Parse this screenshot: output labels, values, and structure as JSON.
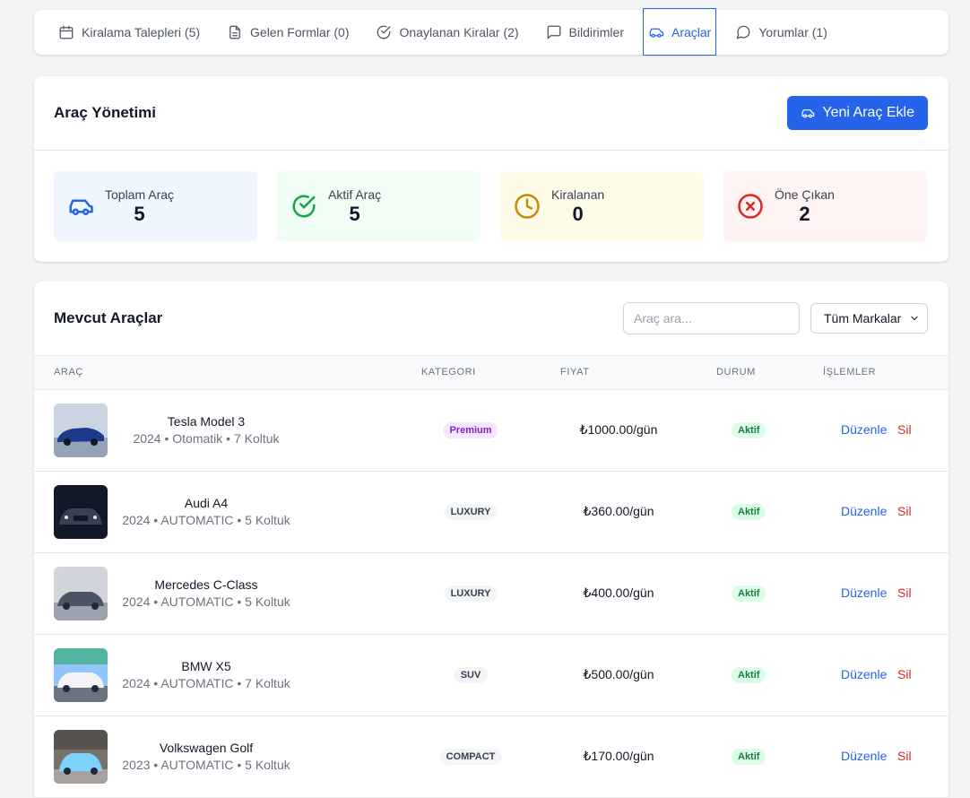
{
  "tabs": [
    {
      "label": "Kiralama Talepleri (5)",
      "icon": "calendar-icon"
    },
    {
      "label": "Gelen Formlar (0)",
      "icon": "document-icon"
    },
    {
      "label": "Onaylanan Kiralar (2)",
      "icon": "check-circle-icon"
    },
    {
      "label": "Bildirimler",
      "icon": "message-square-icon"
    },
    {
      "label": "Araçlar",
      "icon": "car-icon",
      "active": true
    },
    {
      "label": "Yorumlar (1)",
      "icon": "message-circle-icon"
    }
  ],
  "management": {
    "title": "Araç Yönetimi",
    "add_button": "Yeni Araç Ekle",
    "stats": [
      {
        "label": "Toplam Araç",
        "value": "5",
        "icon": "car-icon",
        "bg": "#eff6ff",
        "color": "#2563eb"
      },
      {
        "label": "Aktif Araç",
        "value": "5",
        "icon": "check-circle-icon",
        "bg": "#f0fdf4",
        "color": "#16a34a"
      },
      {
        "label": "Kiralanan",
        "value": "0",
        "icon": "clock-icon",
        "bg": "#fefce8",
        "color": "#ca8a04"
      },
      {
        "label": "Öne Çıkan",
        "value": "2",
        "icon": "x-circle-icon",
        "bg": "#fef2f2",
        "color": "#dc2626"
      }
    ]
  },
  "cars": {
    "title": "Mevcut Araçlar",
    "search_placeholder": "Araç ara...",
    "brand_filter": "Tüm Markalar",
    "columns": [
      "ARAÇ",
      "KATEGORI",
      "FIYAT",
      "DURUM",
      "İŞLEMLER"
    ],
    "rows": [
      {
        "name": "Tesla Model 3",
        "meta": "2024 • Otomatik • 7 Koltuk",
        "category": "Premium",
        "price": "₺1000.00/gün",
        "status": "Aktif",
        "edit": "Düzenle",
        "delete": "Sil",
        "photo_color": "#1e3a8a"
      },
      {
        "name": "Audi A4",
        "meta": "2024 • AUTOMATIC • 5 Koltuk",
        "category": "LUXURY",
        "price": "₺360.00/gün",
        "status": "Aktif",
        "edit": "Düzenle",
        "delete": "Sil",
        "photo_color": "#1f2937"
      },
      {
        "name": "Mercedes C-Class",
        "meta": "2024 • AUTOMATIC • 5 Koltuk",
        "category": "LUXURY",
        "price": "₺400.00/gün",
        "status": "Aktif",
        "edit": "Düzenle",
        "delete": "Sil",
        "photo_color": "#6b7280"
      },
      {
        "name": "BMW X5",
        "meta": "2024 • AUTOMATIC • 7 Koltuk",
        "category": "SUV",
        "price": "₺500.00/gün",
        "status": "Aktif",
        "edit": "Düzenle",
        "delete": "Sil",
        "photo_color": "#e5e7eb"
      },
      {
        "name": "Volkswagen Golf",
        "meta": "2023 • AUTOMATIC • 5 Koltuk",
        "category": "COMPACT",
        "price": "₺170.00/gün",
        "status": "Aktif",
        "edit": "Düzenle",
        "delete": "Sil",
        "photo_color": "#7dd3fc"
      }
    ]
  }
}
